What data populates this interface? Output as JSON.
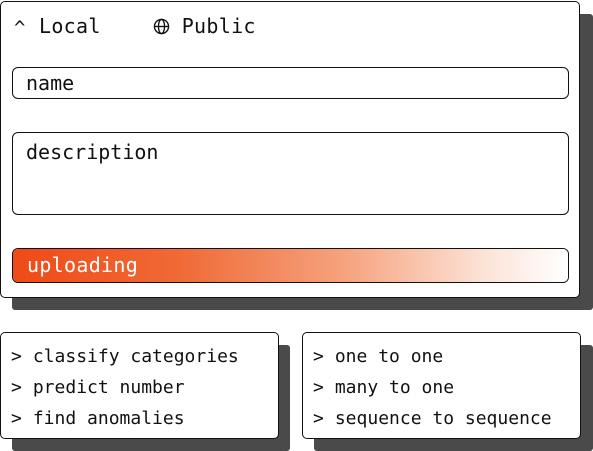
{
  "visibility": {
    "local": {
      "label": "Local",
      "icon": "caret-up-icon",
      "glyph": "^"
    },
    "public": {
      "label": "Public",
      "icon": "globe-icon"
    }
  },
  "form": {
    "name_placeholder": "name",
    "description_placeholder": "description"
  },
  "upload": {
    "status": "uploading",
    "progress": 1.0,
    "accent": "#ef4a17"
  },
  "task_options": [
    {
      "label": "classify categories"
    },
    {
      "label": "predict number"
    },
    {
      "label": "find anomalies"
    }
  ],
  "mapping_options": [
    {
      "label": "one to one"
    },
    {
      "label": "many to one"
    },
    {
      "label": "sequence to sequence"
    }
  ],
  "list_marker": ">",
  "colors": {
    "border": "#111111",
    "shadow": "#4a4a4a",
    "background": "#ffffff"
  }
}
